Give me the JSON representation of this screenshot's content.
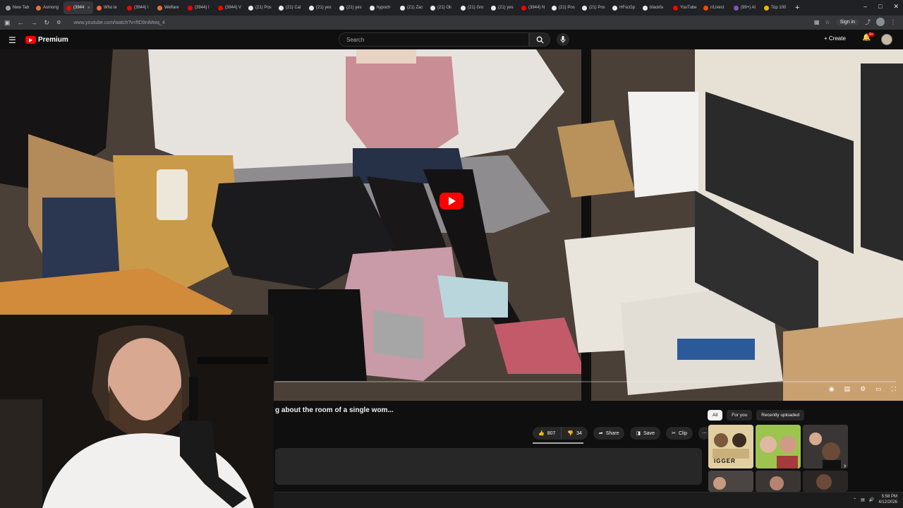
{
  "browser": {
    "tabs": [
      {
        "label": "New Tab",
        "color": "#9aa0a6",
        "active": false
      },
      {
        "label": "Asmong",
        "color": "#e8703a",
        "active": false
      },
      {
        "label": "(3944",
        "color": "#ff0000",
        "active": true
      },
      {
        "label": "Who le",
        "color": "#e8703a",
        "active": false
      },
      {
        "label": "(3944) I",
        "color": "#ff0000",
        "active": false
      },
      {
        "label": "Welfare",
        "color": "#e8703a",
        "active": false
      },
      {
        "label": "(3944) I",
        "color": "#ff0000",
        "active": false
      },
      {
        "label": "(3944) V",
        "color": "#ff0000",
        "active": false
      },
      {
        "label": "(21) Pos",
        "color": "#e8eaed",
        "active": false
      },
      {
        "label": "(21) Cal",
        "color": "#e8eaed",
        "active": false
      },
      {
        "label": "(21) yes",
        "color": "#e8eaed",
        "active": false
      },
      {
        "label": "(21) yes",
        "color": "#e8eaed",
        "active": false
      },
      {
        "label": "hypoch",
        "color": "#e8eaed",
        "active": false
      },
      {
        "label": "(21) Zac",
        "color": "#e8eaed",
        "active": false
      },
      {
        "label": "(21) Oli",
        "color": "#e8eaed",
        "active": false
      },
      {
        "label": "(21) Gro",
        "color": "#e8eaed",
        "active": false
      },
      {
        "label": "(21) yes",
        "color": "#e8eaed",
        "active": false
      },
      {
        "label": "(3944) N",
        "color": "#ff0000",
        "active": false
      },
      {
        "label": "(21) Pos",
        "color": "#e8eaed",
        "active": false
      },
      {
        "label": "(21) Pos",
        "color": "#e8eaed",
        "active": false
      },
      {
        "label": "HFscGp",
        "color": "#e8eaed",
        "active": false
      },
      {
        "label": "blackfa",
        "color": "#e8eaed",
        "active": false
      },
      {
        "label": "YouTube",
        "color": "#ff0000",
        "active": false
      },
      {
        "label": "r/Livest",
        "color": "#ff4500",
        "active": false
      },
      {
        "label": "(99+) Al",
        "color": "#7e57c2",
        "active": false
      },
      {
        "label": "Top 100",
        "color": "#f4b400",
        "active": false
      }
    ],
    "url": "www.youtube.com/watch?v=ftD9niMwq_4",
    "sign_in": "Sign in"
  },
  "youtube": {
    "logo_text": "Premium",
    "search_placeholder": "Search",
    "create_label": "Create",
    "notif_badge": "9+",
    "video_title": "g about the room of a single wom...",
    "likes": "807",
    "dislikes": "34",
    "share_label": "Share",
    "save_label": "Save",
    "clip_label": "Clip",
    "more_label": "⋯",
    "chips": [
      {
        "label": "All",
        "selected": true
      },
      {
        "label": "For you",
        "selected": false
      },
      {
        "label": "Recently uploaded",
        "selected": false
      }
    ],
    "thumb_text": "IGGER"
  },
  "taskbar": {
    "time": "5:58 PM",
    "date": "4/12/2026"
  },
  "colors": {
    "brand_red": "#ff0000",
    "bg": "#0f0f0f",
    "chip_bg": "#272727"
  }
}
